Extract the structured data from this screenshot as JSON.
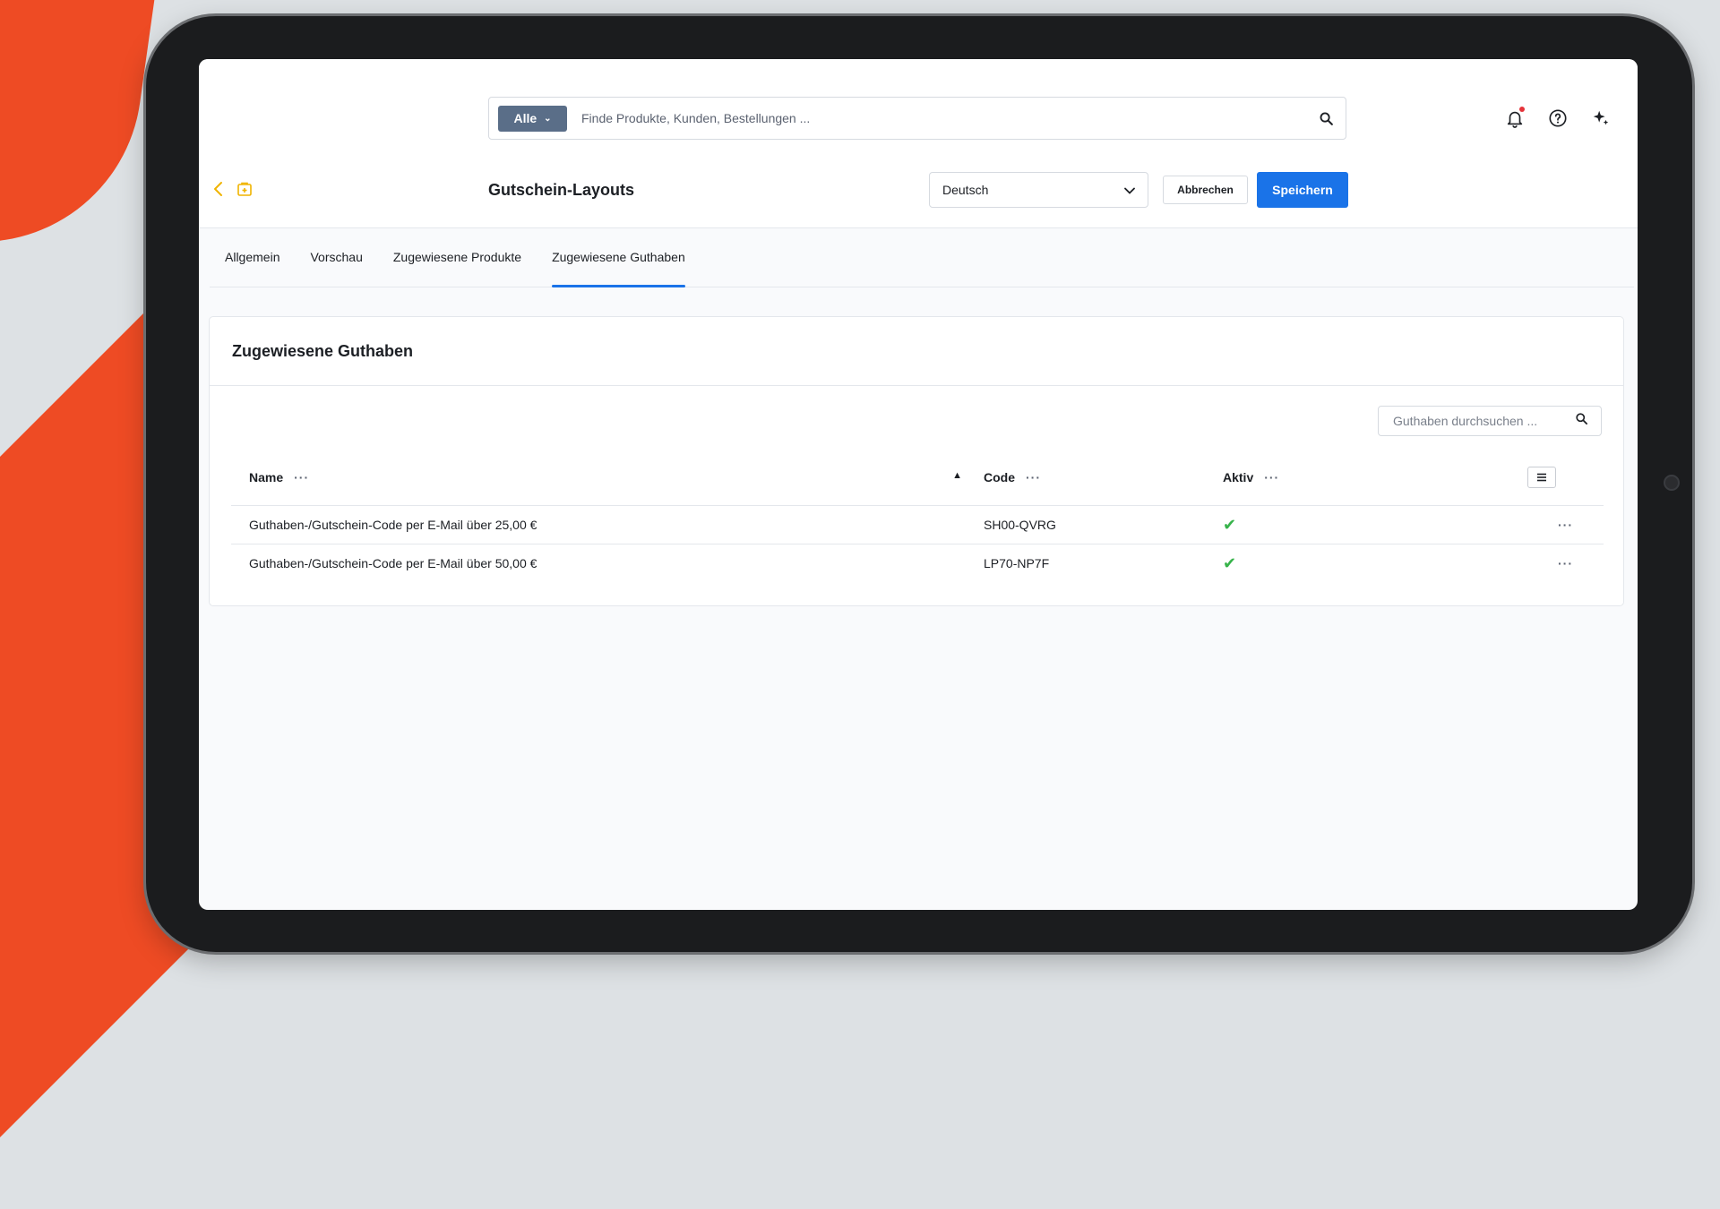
{
  "search": {
    "scope_label": "Alle",
    "placeholder": "Finde Produkte, Kunden, Bestellungen ..."
  },
  "header": {
    "title": "Gutschein-Layouts",
    "language": "Deutsch",
    "cancel_label": "Abbrechen",
    "save_label": "Speichern"
  },
  "tabs": [
    {
      "label": "Allgemein",
      "active": false
    },
    {
      "label": "Vorschau",
      "active": false
    },
    {
      "label": "Zugewiesene Produkte",
      "active": false
    },
    {
      "label": "Zugewiesene Guthaben",
      "active": true
    }
  ],
  "card": {
    "title": "Zugewiesene Guthaben",
    "search_placeholder": "Guthaben durchsuchen ...",
    "columns": {
      "name": "Name",
      "code": "Code",
      "aktiv": "Aktiv"
    },
    "rows": [
      {
        "name": "Guthaben-/Gutschein-Code per E-Mail über 25,00 €",
        "code": "SH00-QVRG",
        "aktiv": true
      },
      {
        "name": "Guthaben-/Gutschein-Code per E-Mail über 50,00 €",
        "code": "LP70-NP7F",
        "aktiv": true
      }
    ]
  },
  "colors": {
    "primary": "#1a73e8",
    "scope_button": "#5a6e88",
    "accent_orange": "#ee4b24",
    "check_green": "#37b34a",
    "back_icon": "#f0b400"
  },
  "icons": {
    "search": "search-icon",
    "notifications": "bell-icon",
    "help": "help-icon",
    "ai": "sparkle-icon",
    "back": "chevron-left-icon",
    "document": "document-icon",
    "columns_menu": "list-icon",
    "row_menu": "more-icon"
  }
}
